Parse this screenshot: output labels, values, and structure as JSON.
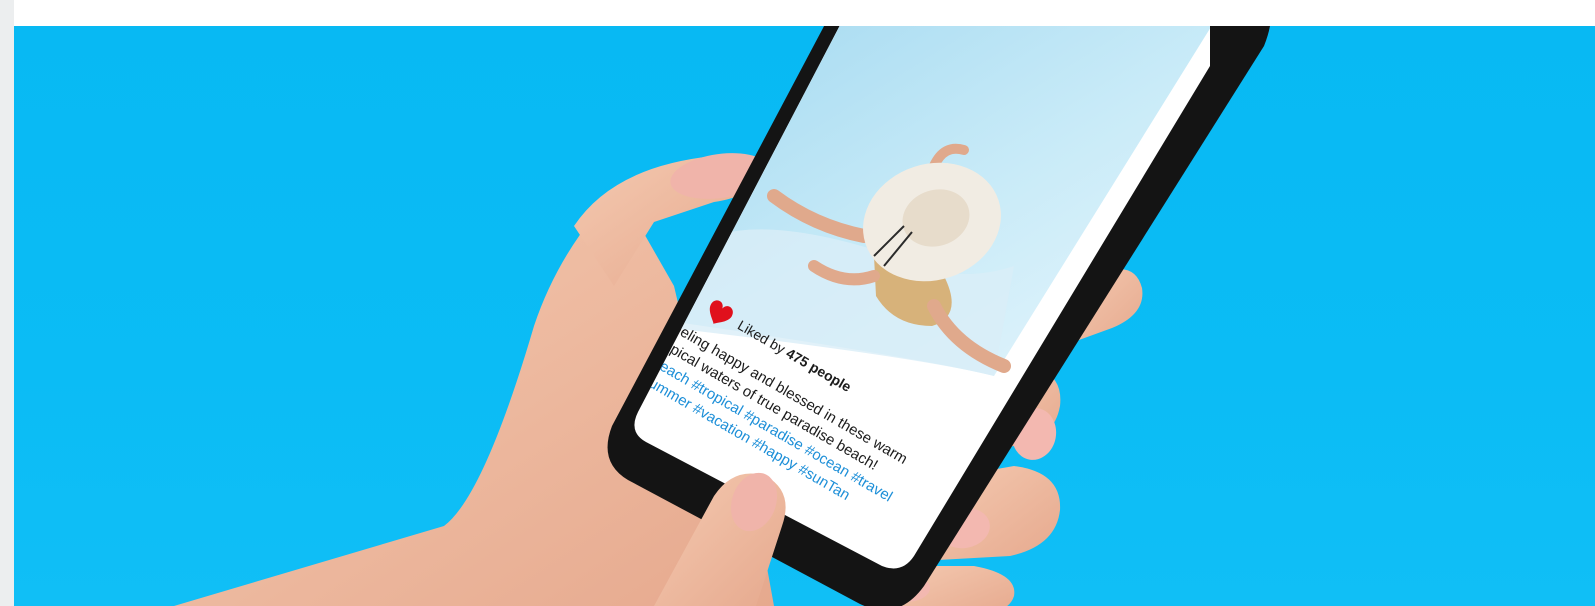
{
  "post": {
    "likes_prefix": "Liked by",
    "likes_count": "475 people",
    "caption_line_1": "Feeling happy and blessed in these warm",
    "caption_line_2": "tropical waters of true paradise beach!",
    "hashtags_line_1": "#beach #tropical #paradise #ocean #travel",
    "hashtags_line_2": "#summer #vacation #happy #sunTan"
  },
  "colors": {
    "background": "#08b9f3",
    "heart": "#e0101c",
    "hashtag": "#1d8fd8"
  },
  "icons": {
    "like": "heart-icon"
  }
}
